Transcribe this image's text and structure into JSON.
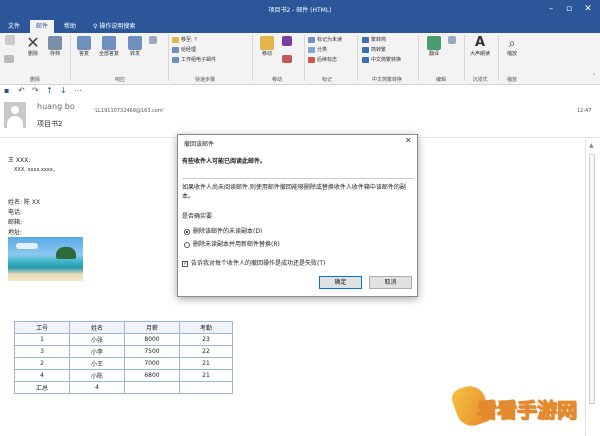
{
  "window": {
    "title": "项目书2 - 邮件 (HTML)"
  },
  "tabs": [
    {
      "label": "文件"
    },
    {
      "label": "邮件"
    },
    {
      "label": "帮助"
    }
  ],
  "tell_me": "操作说明搜索",
  "ribbon": {
    "delete": "删除",
    "archive": "存档",
    "reply": "答复",
    "reply_all": "全部答复",
    "forward": "转发",
    "group_delete": "删除",
    "group_respond": "响应",
    "quick_steps": [
      "移至: ?",
      "给经理",
      "工作组电子邮件"
    ],
    "group_quick_steps": "快速步骤",
    "move": "移动",
    "group_move": "移动",
    "tag_items": [
      "标记为未读",
      "分类",
      "后续标志"
    ],
    "group_tags": "标记",
    "chinese_items": [
      "繁转简",
      "简转繁",
      "中文简繁转换"
    ],
    "group_chinese": "中文简繁转换",
    "translate": "翻译",
    "group_edit": "编辑",
    "immersive": "大声朗读",
    "group_immersive": "沉浸式",
    "zoom": "缩放",
    "group_zoom": "缩放"
  },
  "message": {
    "sender": "huang bo",
    "recipient": "'LL19110732469@163.com'",
    "subject": "项目书2",
    "time": "12:47",
    "greeting": "王 XXX:",
    "greeting_line": "XXX, xxxx,xxxx。",
    "name_line": "姓名: 陈 XX",
    "phone_label": "电话:",
    "email_label": "邮箱:",
    "address_label": "地址:"
  },
  "table": {
    "headers": [
      "工号",
      "姓名",
      "月薪",
      "考勤"
    ],
    "rows": [
      [
        "1",
        "小张",
        "8000",
        "23"
      ],
      [
        "3",
        "小李",
        "7500",
        "22"
      ],
      [
        "2",
        "小王",
        "7000",
        "21"
      ],
      [
        "4",
        "小陈",
        "6800",
        "21"
      ]
    ],
    "total": [
      "汇总",
      "4",
      "",
      ""
    ]
  },
  "dialog": {
    "title": "撤回该邮件",
    "headline": "有些收件人可能已阅读此邮件。",
    "description": "如果收件人尚未阅读邮件,则使用邮件撤回能够删除或替换收件人收件箱中该邮件的副本。",
    "question": "是否确实要",
    "option1": "删除该邮件的未读副本(D)",
    "option2": "删除未读副本并用新邮件替换(R)",
    "checkbox": "告诉我对每个收件人的撤回操作是成功还是失败(T)",
    "ok": "确定",
    "cancel": "取消"
  },
  "watermark": "看看手游网",
  "colors": {
    "accent": "#2b579a",
    "ribbon_bg": "#f3f3f3",
    "table_border": "#9bb6d6"
  }
}
